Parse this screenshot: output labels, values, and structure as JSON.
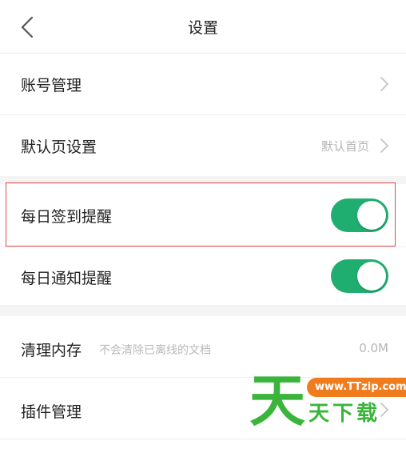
{
  "header": {
    "title": "设置",
    "back_icon": "chevron-left-icon"
  },
  "rows": {
    "account": {
      "label": "账号管理"
    },
    "default_page": {
      "label": "默认页设置",
      "value": "默认首页"
    },
    "daily_signin": {
      "label": "每日签到提醒",
      "enabled": true
    },
    "daily_notify": {
      "label": "每日通知提醒",
      "enabled": true
    },
    "clear_cache": {
      "label": "清理内存",
      "hint": "不会清除已离线的文档",
      "value": "0.0M"
    },
    "plugins": {
      "label": "插件管理"
    }
  },
  "watermark": {
    "big_char": "天",
    "url": "www.TTzip.com",
    "text": "天下载"
  },
  "colors": {
    "toggle_on": "#1fae70",
    "highlight_border": "#e24b4b",
    "watermark_green": "#3ab43a",
    "watermark_orange": "#f07d1d"
  }
}
